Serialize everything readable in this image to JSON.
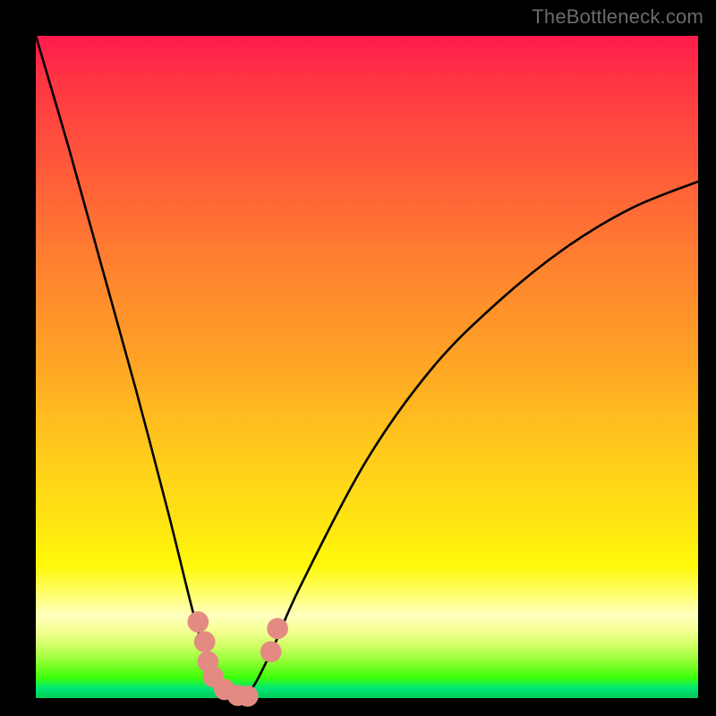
{
  "watermark": "TheBottleneck.com",
  "colors": {
    "frame": "#000000",
    "curve": "#000000",
    "marker": "#e38b82"
  },
  "chart_data": {
    "type": "line",
    "title": "",
    "xlabel": "",
    "ylabel": "",
    "xlim": [
      0,
      100
    ],
    "ylim": [
      0,
      100
    ],
    "grid": false,
    "legend": false,
    "series": [
      {
        "name": "bottleneck-curve",
        "x": [
          0,
          5,
          10,
          15,
          20,
          24,
          26,
          28,
          30,
          31,
          33,
          36,
          40,
          50,
          60,
          70,
          80,
          90,
          100
        ],
        "y": [
          100,
          83,
          65,
          47,
          28,
          12,
          6,
          2,
          0,
          0,
          2,
          8,
          17,
          36,
          50,
          60,
          68,
          74,
          78
        ]
      }
    ],
    "markers": [
      {
        "x": 24.5,
        "y": 11.5,
        "r": 1.6
      },
      {
        "x": 25.5,
        "y": 8.5,
        "r": 1.6
      },
      {
        "x": 26.0,
        "y": 5.5,
        "r": 1.6
      },
      {
        "x": 26.8,
        "y": 3.2,
        "r": 1.6
      },
      {
        "x": 28.5,
        "y": 1.3,
        "r": 1.6
      },
      {
        "x": 30.5,
        "y": 0.4,
        "r": 1.6
      },
      {
        "x": 32.0,
        "y": 0.3,
        "r": 1.6
      },
      {
        "x": 35.5,
        "y": 7.0,
        "r": 1.6
      },
      {
        "x": 36.5,
        "y": 10.5,
        "r": 1.6
      }
    ],
    "vertex": {
      "x": 31,
      "y": 0
    }
  }
}
